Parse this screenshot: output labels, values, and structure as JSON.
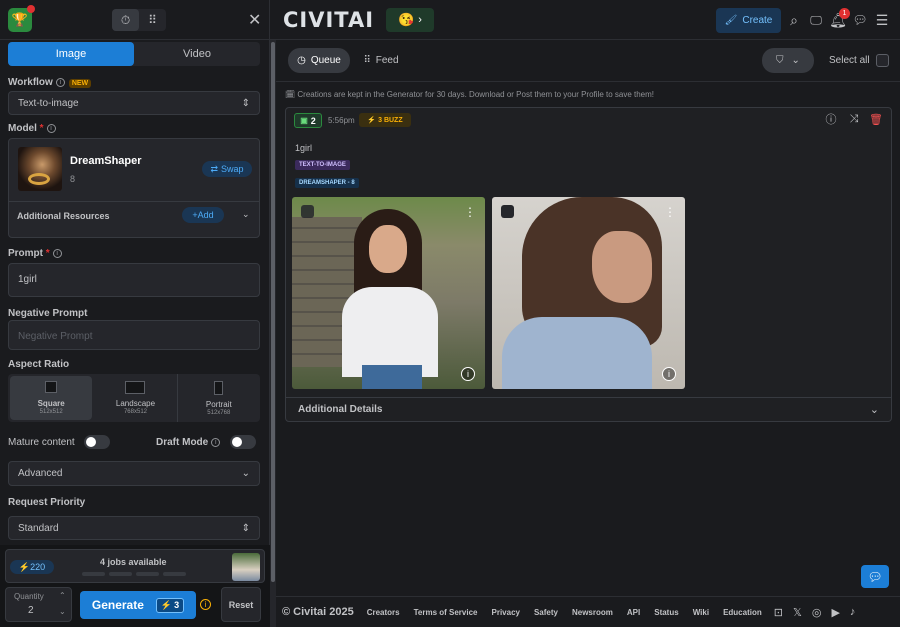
{
  "sidebar": {
    "tabs": [
      {
        "label": "Image"
      },
      {
        "label": "Video"
      }
    ],
    "workflow": {
      "label": "Workflow",
      "badge": "NEW",
      "value": "Text-to-image"
    },
    "model": {
      "label": "Model",
      "required": "*",
      "name": "DreamShaper",
      "version": "8",
      "swap": "Swap",
      "additional": "Additional Resources",
      "add": "+Add"
    },
    "prompt": {
      "label": "Prompt",
      "required": "*",
      "value": "1girl"
    },
    "negative": {
      "label": "Negative Prompt",
      "placeholder": "Negative Prompt"
    },
    "aspect": {
      "label": "Aspect Ratio",
      "options": [
        {
          "name": "Square",
          "size": "512x512"
        },
        {
          "name": "Landscape",
          "size": "768x512"
        },
        {
          "name": "Portrait",
          "size": "512x768"
        }
      ]
    },
    "mature": {
      "label": "Mature content"
    },
    "draft": {
      "label": "Draft Mode"
    },
    "advanced": {
      "label": "Advanced"
    },
    "priority": {
      "label": "Request Priority",
      "value": "Standard"
    },
    "jobs": {
      "buzz": "220",
      "text": "4 jobs available"
    },
    "quantity": {
      "label": "Quantity",
      "value": "2"
    },
    "generate": {
      "label": "Generate",
      "cost": "3"
    },
    "reset": {
      "label": "Reset"
    }
  },
  "header": {
    "brand": "CIVITAI",
    "create": "Create",
    "notifications": "1"
  },
  "toolbar": {
    "queue": "Queue",
    "feed": "Feed",
    "select_all": "Select all"
  },
  "notice": "Creations are kept in the Generator for 30 days. Download or Post them to your Profile to save them!",
  "job": {
    "count": "2",
    "time": "5:56pm",
    "buzz": "3 BUZZ",
    "prompt": "1girl",
    "tags": [
      "TEXT-TO-IMAGE",
      "DREAMSHAPER - 8"
    ],
    "details": "Additional Details"
  },
  "footer": {
    "copyright": "© Civitai 2025",
    "links": [
      "Creators",
      "Terms of Service",
      "Privacy",
      "Safety",
      "Newsroom",
      "API",
      "Status",
      "Wiki",
      "Education"
    ]
  },
  "colors": {
    "accent": "#1c7ed6",
    "brand_green": "#2b8a3e",
    "buzz": "#fab005"
  }
}
